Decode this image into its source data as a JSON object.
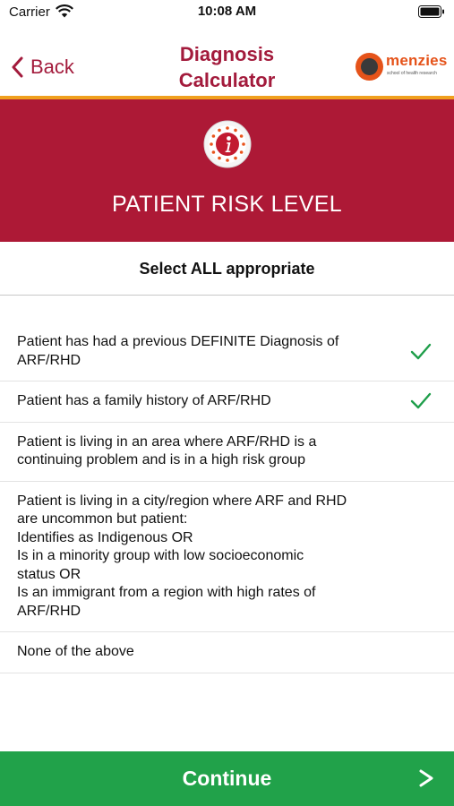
{
  "status_bar": {
    "carrier": "Carrier",
    "time": "10:08 AM"
  },
  "nav": {
    "back_label": "Back",
    "title": "Diagnosis Calculator"
  },
  "logo": {
    "name": "menzies",
    "tagline": "school of health research"
  },
  "hero": {
    "icon": "info-icon",
    "title": "PATIENT RISK LEVEL"
  },
  "instruction": "Select ALL appropriate",
  "options": [
    {
      "text": "Patient has had a previous DEFINITE Diagnosis of\nARF/RHD",
      "checked": true
    },
    {
      "text": "Patient has a family history of ARF/RHD",
      "checked": true
    },
    {
      "text": "Patient is living in an area where ARF/RHD is a\ncontinuing problem and is in a high risk group",
      "checked": false
    },
    {
      "text": "Patient is living in a city/region where ARF and RHD\nare uncommon but patient:\nIdentifies as Indigenous OR\nIs in a minority group with low socioeconomic\nstatus OR\nIs an immigrant from a region with high rates of\nARF/RHD",
      "checked": false
    },
    {
      "text": "None of the above",
      "checked": false
    }
  ],
  "continue_button": {
    "label": "Continue",
    "icon": "chevron-right-icon"
  },
  "colors": {
    "brand": "#ad1936",
    "accent": "#f0a01e",
    "success": "#21a24a",
    "check": "#1e9e4a"
  }
}
